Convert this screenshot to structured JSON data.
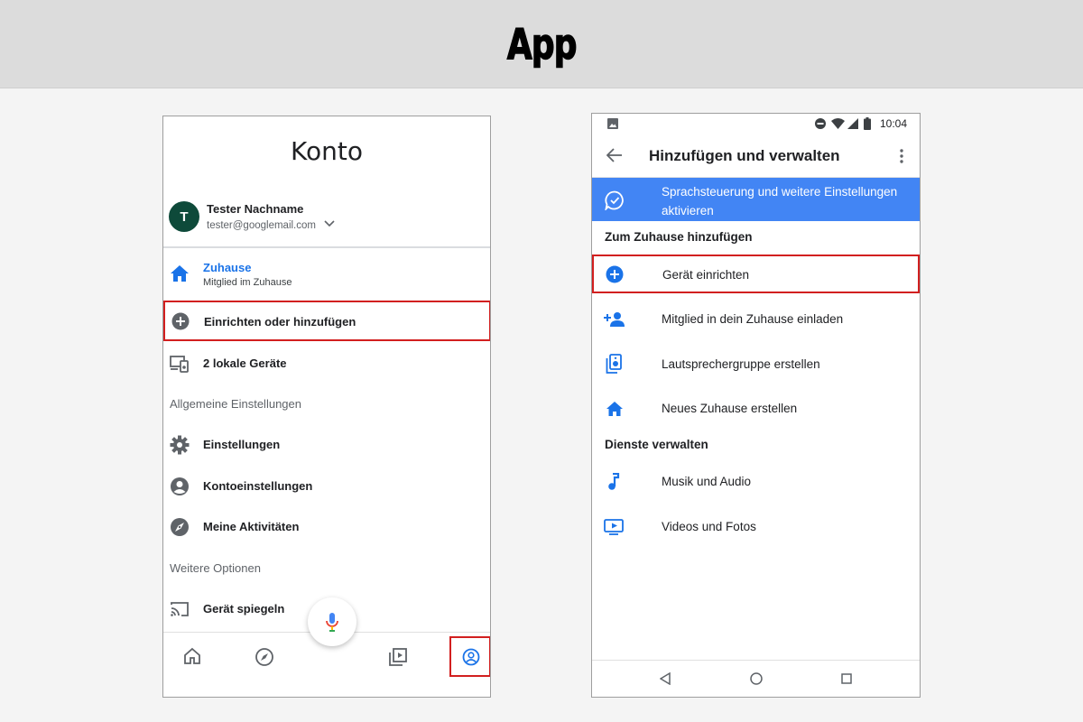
{
  "banner": {
    "title": "App"
  },
  "left_phone": {
    "title": "Konto",
    "user": {
      "initial": "T",
      "name": "Tester Nachname",
      "email": "tester@googlemail.com"
    },
    "home": {
      "label": "Zuhause",
      "sublabel": "Mitglied im Zuhause"
    },
    "setup_add_label": "Einrichten oder hinzufügen",
    "local_devices_label": "2 lokale Geräte",
    "general_settings_section": "Allgemeine Einstellungen",
    "settings_label": "Einstellungen",
    "account_settings_label": "Kontoeinstellungen",
    "activities_label": "Meine Aktivitäten",
    "more_options_section": "Weitere Optionen",
    "mirror_device_label": "Gerät spiegeln",
    "colors": {
      "accent_blue": "#1a73e8",
      "highlight_red": "#d21f1f",
      "avatar_green": "#0e4a3a"
    }
  },
  "right_phone": {
    "status_time": "10:04",
    "title": "Hinzufügen und verwalten",
    "banner_text": "Sprachsteuerung und weitere Einstellungen aktivieren",
    "add_to_home_section": "Zum Zuhause hinzufügen",
    "items": {
      "setup_device": "Gerät einrichten",
      "invite_member": "Mitglied in dein Zuhause einladen",
      "speaker_group": "Lautsprechergruppe erstellen",
      "new_home": "Neues Zuhause erstellen"
    },
    "manage_services_section": "Dienste verwalten",
    "services": {
      "music": "Musik und Audio",
      "videos": "Videos und Fotos"
    },
    "colors": {
      "banner_blue": "#4285f4",
      "icon_blue": "#1a73e8"
    }
  }
}
